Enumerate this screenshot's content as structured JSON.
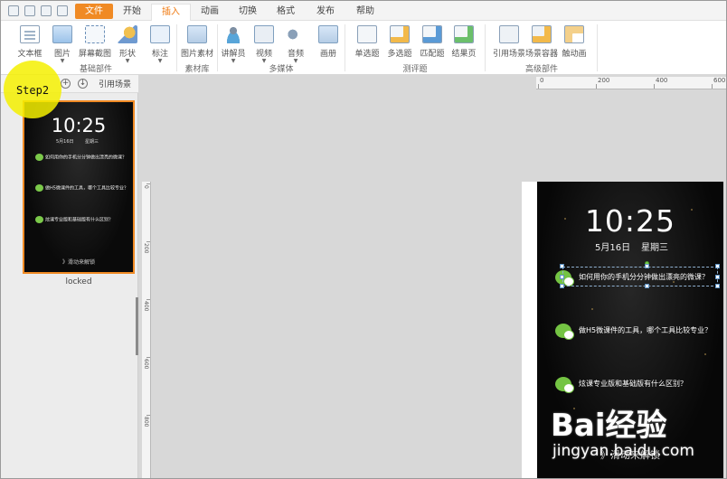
{
  "menu": {
    "tabs": [
      "文件",
      "开始",
      "插入",
      "动画",
      "切换",
      "格式",
      "发布",
      "帮助"
    ],
    "active": "插入"
  },
  "ribbon": {
    "groups": [
      {
        "label": "基础部件",
        "buttons": [
          "文本框",
          "图片",
          "屏幕截图",
          "形状",
          "标注"
        ]
      },
      {
        "label": "素材库",
        "buttons": [
          "图片素材"
        ]
      },
      {
        "label": "多媒体",
        "buttons": [
          "讲解员",
          "视频",
          "音频",
          "画册"
        ]
      },
      {
        "label": "测评题",
        "buttons": [
          "单选题",
          "多选题",
          "匹配题",
          "结果页"
        ]
      },
      {
        "label": "高级部件",
        "buttons": [
          "引用场景",
          "场景容器",
          "触动画"
        ]
      }
    ]
  },
  "left_panel": {
    "cite_tab": "引用场景",
    "thumb_label": "locked"
  },
  "overlay": {
    "step_text": "Step2"
  },
  "slide": {
    "time": "10:25",
    "date": "5月16日",
    "weekday": "星期三",
    "questions": [
      "如何用你的手机分分钟做出漂亮的微课？",
      "做H5微课件的工具，哪个工具比较专业？",
      "炫课专业版和基础版有什么区别？"
    ],
    "bottom": "》滑动来解锁"
  },
  "ruler": {
    "top_labels": [
      "0",
      "200",
      "400",
      "600"
    ],
    "left_labels": [
      "0",
      "200",
      "400",
      "600",
      "800"
    ]
  },
  "watermark": {
    "logo": "Bai经验",
    "sub": "jingyan.baidu.com"
  }
}
